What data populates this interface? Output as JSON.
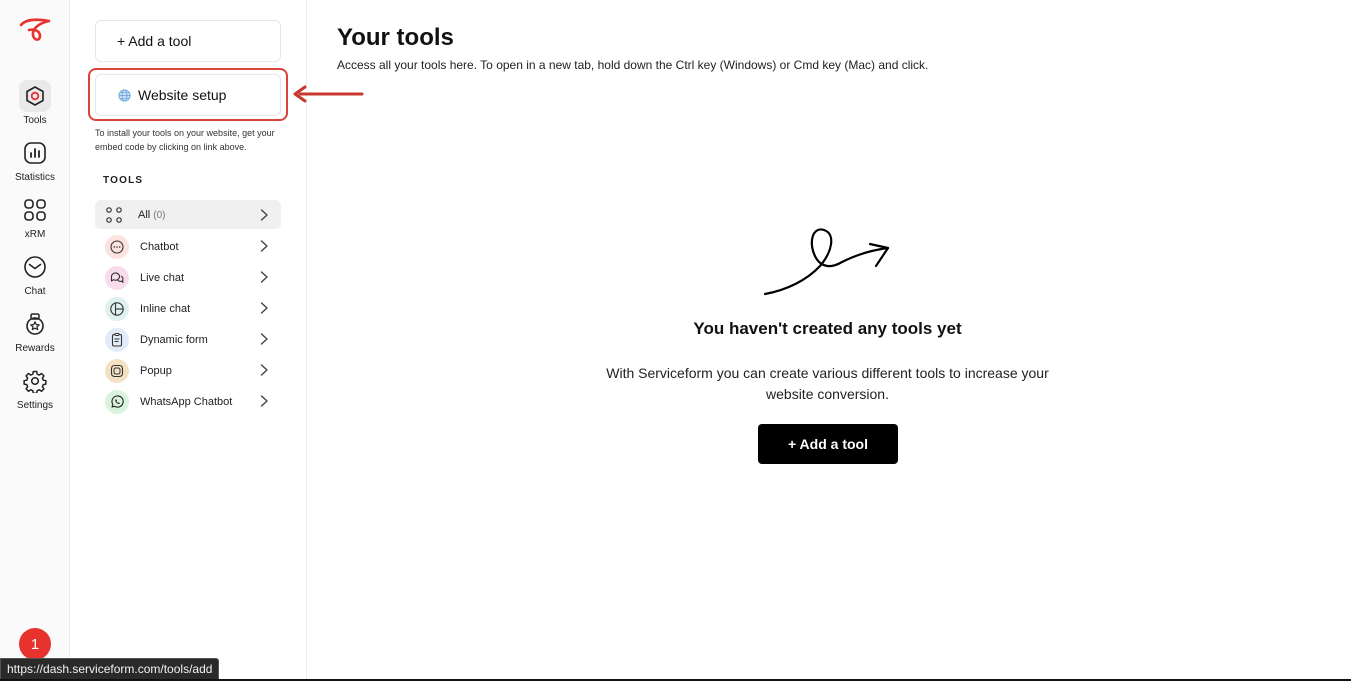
{
  "rail": {
    "items": [
      {
        "label": "Tools",
        "icon": "tools-icon",
        "active": true
      },
      {
        "label": "Statistics",
        "icon": "statistics-icon"
      },
      {
        "label": "xRM",
        "icon": "grid-icon"
      },
      {
        "label": "Chat",
        "icon": "chat-icon"
      },
      {
        "label": "Rewards",
        "icon": "rewards-icon"
      },
      {
        "label": "Settings",
        "icon": "gear-icon"
      }
    ],
    "notification_count": "1"
  },
  "panel": {
    "add_tool_label": "+ Add a tool",
    "website_setup_label": "Website setup",
    "help_text": "To install your tools on your website, get your embed code by clicking on link above.",
    "section_title": "TOOLS",
    "tools": [
      {
        "label": "All",
        "count": "(0)",
        "icon": "all-icon"
      },
      {
        "label": "Chatbot",
        "icon": "chatbot-icon"
      },
      {
        "label": "Live chat",
        "icon": "live-chat-icon"
      },
      {
        "label": "Inline chat",
        "icon": "inline-chat-icon"
      },
      {
        "label": "Dynamic form",
        "icon": "dynamic-form-icon"
      },
      {
        "label": "Popup",
        "icon": "popup-icon"
      },
      {
        "label": "WhatsApp Chatbot",
        "icon": "whatsapp-icon"
      }
    ]
  },
  "main": {
    "title": "Your tools",
    "subtitle": "Access all your tools here. To open in a new tab, hold down the Ctrl key (Windows) or Cmd key (Mac) and click.",
    "empty_title": "You haven't created any tools yet",
    "empty_desc": "With Serviceform you can create various different tools to increase your website conversion.",
    "cta_label": "+ Add a tool"
  },
  "status_bar": {
    "url": "https://dash.serviceform.com/tools/add"
  },
  "colors": {
    "brand_red": "#e8322e",
    "highlight_red": "#d8433a",
    "cta_bg": "#000000"
  }
}
